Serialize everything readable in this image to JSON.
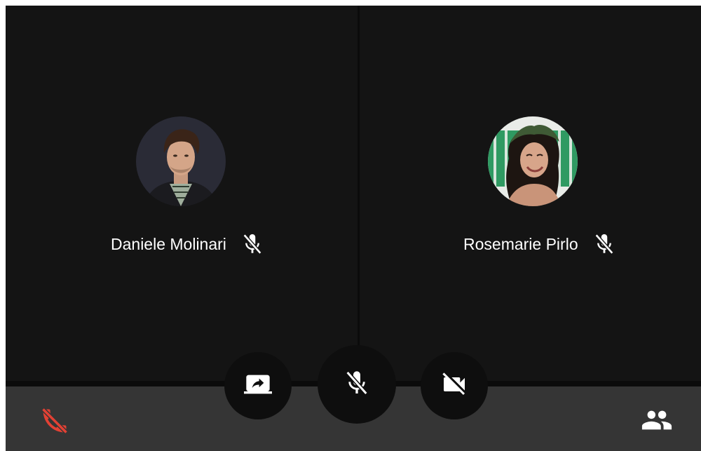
{
  "participants": [
    {
      "name": "Daniele Molinari",
      "mic_icon": "mic-off-icon",
      "avatar": "avatar-photo"
    },
    {
      "name": "Rosemarie Pirlo",
      "mic_icon": "mic-off-icon",
      "avatar": "avatar-photo"
    }
  ],
  "controls": {
    "share_icon": "screen-share-icon",
    "mute_icon": "mic-off-icon",
    "video_icon": "video-off-icon",
    "hangup_icon": "phone-hangup-icon",
    "participants_icon": "people-icon"
  },
  "colors": {
    "background": "#141414",
    "bottom_bar": "#353535",
    "control_button": "#0e0e0e",
    "hangup": "#e34134",
    "icon": "#ffffff"
  }
}
